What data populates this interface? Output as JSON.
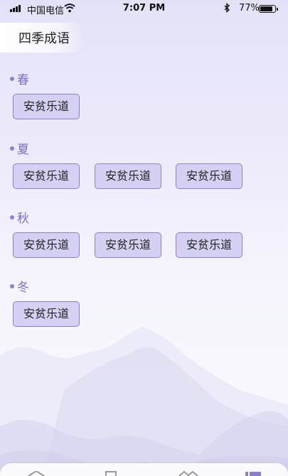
{
  "status_bar": {
    "carrier": "中国电信",
    "time": "7:07 PM",
    "battery": "77%",
    "battery_level": 0.77
  },
  "header": {
    "title": "四季成语"
  },
  "seasons": [
    {
      "name": "春",
      "idioms": [
        "安贫乐道"
      ]
    },
    {
      "name": "夏",
      "idioms": [
        "安贫乐道",
        "安贫乐道",
        "安贫乐道"
      ]
    },
    {
      "name": "秋",
      "idioms": [
        "安贫乐道",
        "安贫乐道",
        "安贫乐道"
      ]
    },
    {
      "name": "冬",
      "idioms": [
        "安贫乐道"
      ]
    }
  ],
  "tab_bar": {
    "icons": [
      "home-icon",
      "book-icon",
      "mountain-icon",
      "profile-icon"
    ]
  },
  "colors": {
    "accent": "#7a6fd0",
    "tag_bg": "#d5d1f4",
    "tag_border": "#8a80cc"
  }
}
